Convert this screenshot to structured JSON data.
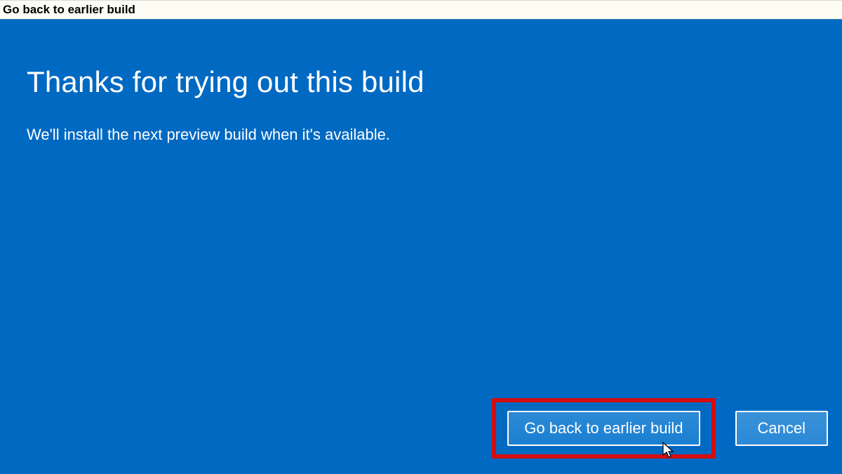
{
  "window": {
    "title": "Go back to earlier build"
  },
  "main": {
    "heading": "Thanks for trying out this build",
    "subtext": "We'll install the next preview build when it's available."
  },
  "buttons": {
    "primary_label": "Go back to earlier build",
    "cancel_label": "Cancel"
  }
}
